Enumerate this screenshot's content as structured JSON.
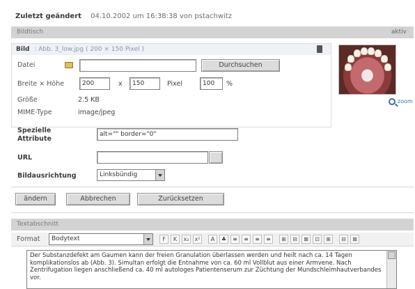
{
  "top": {
    "label": "Zuletzt geändert",
    "meta": "04.10.2002 um 16:38:38 von pstachwitz"
  },
  "section1": {
    "title": "Bildtisch",
    "right": "aktiv"
  },
  "image": {
    "header_label": "Bild",
    "header_info": ": Abb. 3_low.jpg ( 200 × 150 Pixel )",
    "datei_label": "Datei",
    "datei_value": "",
    "durchsuchen": "Durchsuchen",
    "size_label": "Breite × Höhe",
    "width": "200",
    "x": "x",
    "height": "150",
    "pixel": "Pixel",
    "percent": "100",
    "percent_sign": "%",
    "groesse_label": "Größe",
    "groesse_value": "2.5 KB",
    "mime_label": "MIME-Type",
    "mime_value": "image/jpeg",
    "zoom_text": "zoom"
  },
  "fields": {
    "spezielle_label": "Spezielle Attribute",
    "spezielle_value": "alt=\"\" border=\"0\"",
    "url_label": "URL",
    "url_value": "",
    "ausrichtung_label": "Bildausrichtung",
    "ausrichtung_value": "Linksbündig"
  },
  "buttons": {
    "aendern": "ändern",
    "abbrechen": "Abbrechen",
    "zuruecksetzen": "Zurücksetzen"
  },
  "section2": {
    "title": "Textabschnitt"
  },
  "editor": {
    "format_label": "Format",
    "format_value": "Bodytext",
    "tool_labels": [
      "F",
      "K",
      "x₂",
      "x²",
      "A",
      "♣",
      "≡",
      "≡",
      "≡",
      "≡",
      "⊞",
      "⊟",
      "⊠",
      "⊡",
      "⊞",
      "⊟",
      "⊠"
    ],
    "text": "Der Substanzdefekt am Gaumen kann der freien Granulation überlassen werden und heilt nach ca. 14 Tagen komplikationslos ab (Abb. 3). Simultan erfolgt die Entnahme von ca. 60 ml Vollblut aus einer Armvene. Nach Zentrifugation liegen anschließend ca. 40 ml autologes Patientenserum zur Züchtung der Mundschleimhautverbandes vor."
  }
}
